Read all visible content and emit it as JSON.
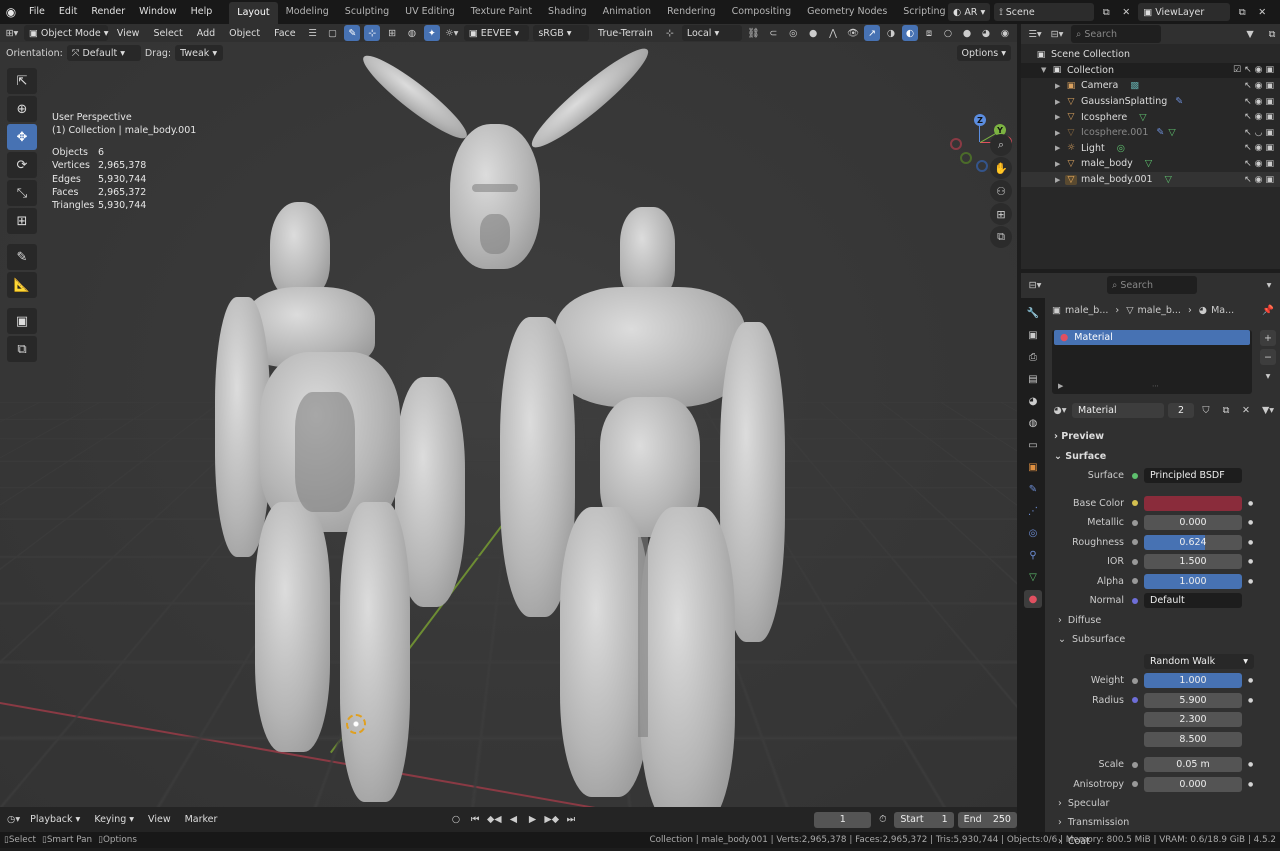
{
  "menubar": {
    "items": [
      "File",
      "Edit",
      "Render",
      "Window",
      "Help"
    ],
    "workspaces": [
      "Layout",
      "Modeling",
      "Sculpting",
      "UV Editing",
      "Texture Paint",
      "Shading",
      "Animation",
      "Rendering",
      "Compositing",
      "Geometry Nodes",
      "Scripting"
    ],
    "active_workspace": "Layout",
    "ar_label": "AR",
    "scene": "Scene",
    "view_layer": "ViewLayer"
  },
  "viewport_header": {
    "mode": "Object Mode",
    "menus": [
      "View",
      "Select",
      "Add",
      "Object",
      "Face"
    ],
    "engine": "EEVEE",
    "color_space": "sRGB",
    "terrain": "True-Terrain",
    "orientation": "Local"
  },
  "tool_settings": {
    "orientation_label": "Orientation:",
    "orientation_value": "Default",
    "drag_label": "Drag:",
    "drag_value": "Tweak",
    "options": "Options"
  },
  "overlay": {
    "perspective": "User Perspective",
    "collection": "(1) Collection | male_body.001",
    "stats": [
      {
        "k": "Objects",
        "v": "6"
      },
      {
        "k": "Vertices",
        "v": "2,965,378"
      },
      {
        "k": "Edges",
        "v": "5,930,744"
      },
      {
        "k": "Faces",
        "v": "2,965,372"
      },
      {
        "k": "Triangles",
        "v": "5,930,744"
      }
    ]
  },
  "gizmo": {
    "x": "X",
    "y": "Y",
    "z": "Z"
  },
  "outliner": {
    "title": "Scene Collection",
    "collection": "Collection",
    "search_placeholder": "Search",
    "items": [
      "Camera",
      "GaussianSplatting",
      "Icosphere",
      "Icosphere.001",
      "Light",
      "male_body",
      "male_body.001"
    ]
  },
  "properties": {
    "search_placeholder": "Search",
    "breadcrumb": [
      "male_b...",
      "male_b...",
      "Ma..."
    ],
    "slot": "Material",
    "material_name": "Material",
    "users": "2",
    "preview": "Preview",
    "surface_section": "Surface",
    "surface_label": "Surface",
    "surface_value": "Principled BSDF",
    "rows": [
      {
        "label": "Base Color",
        "value": "",
        "type": "color"
      },
      {
        "label": "Metallic",
        "value": "0.000",
        "type": "num"
      },
      {
        "label": "Roughness",
        "value": "0.624",
        "type": "blue"
      },
      {
        "label": "IOR",
        "value": "1.500",
        "type": "num"
      },
      {
        "label": "Alpha",
        "value": "1.000",
        "type": "blue"
      },
      {
        "label": "Normal",
        "value": "Default",
        "type": "dark"
      }
    ],
    "diffuse": "Diffuse",
    "subsurface": "Subsurface",
    "subsurface_method": "Random Walk",
    "weight_label": "Weight",
    "weight_value": "1.000",
    "radius_label": "Radius",
    "radius_values": [
      "5.900",
      "2.300",
      "8.500"
    ],
    "scale_label": "Scale",
    "scale_value": "0.05 m",
    "aniso_label": "Anisotropy",
    "aniso_value": "0.000",
    "specular": "Specular",
    "transmission": "Transmission",
    "coat": "Coat",
    "base_color_hex": "#8a2c3b"
  },
  "timeline": {
    "menus": [
      "Playback",
      "Keying",
      "View",
      "Marker"
    ],
    "current_frame": "1",
    "start_label": "Start",
    "start": "1",
    "end_label": "End",
    "end": "250"
  },
  "statusbar": {
    "left": [
      "Select",
      "Smart Pan",
      "Options"
    ],
    "right": "Collection | male_body.001 | Verts:2,965,378 | Faces:2,965,372 | Tris:5,930,744 | Objects:0/6 | Memory: 800.5 MiB | VRAM: 0.6/18.9 GiB | 4.5.2"
  }
}
